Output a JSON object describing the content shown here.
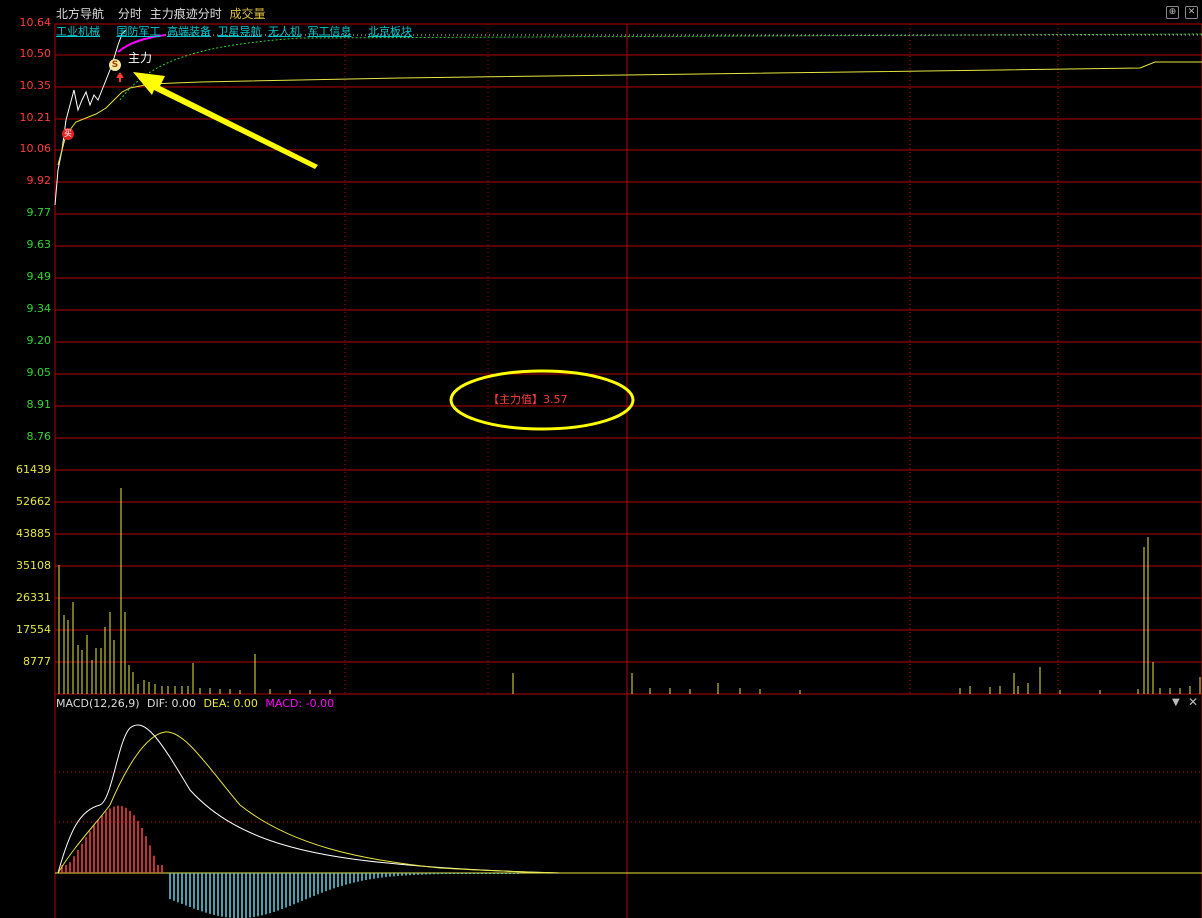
{
  "header": {
    "stock_name": "北方导航",
    "mode": "分时",
    "indicator": "主力痕迹分时",
    "volume_label": "成交量"
  },
  "concept_tags": [
    "工业机械",
    "国防军工",
    "高端装备",
    "卫星导航",
    "无人机",
    "军工信息",
    "北京板块"
  ],
  "price_axis": [
    "10.64",
    "10.50",
    "10.35",
    "10.21",
    "10.06",
    "9.92",
    "9.77",
    "9.63",
    "9.49",
    "9.34",
    "9.20",
    "9.05",
    "8.91",
    "8.76"
  ],
  "volume_axis": [
    "61439",
    "52662",
    "43885",
    "35108",
    "26331",
    "17554",
    "8777"
  ],
  "annotations": {
    "main_force_marker": "主力",
    "main_force_value_label": "【主力值】",
    "main_force_value": "3.57",
    "badge_top": "S",
    "badge_left": "买"
  },
  "macd": {
    "name": "MACD(12,26,9)",
    "dif_label": "DIF:",
    "dif_value": "0.00",
    "dea_label": "DEA:",
    "dea_value": "0.00",
    "macd_label": "MACD:",
    "macd_value": "-0.00"
  },
  "colors": {
    "grid": "#b40000",
    "price_up": "#ff3b3b",
    "price_down": "#2fd52f",
    "avg_line": "#e6e640",
    "volume_bar": "#e6e640",
    "macd_pos": "#ff4444",
    "macd_neg": "#5fd3e6",
    "macd_label": "#ff00ff",
    "arrow": "#ffff00",
    "tag": "#00c8d0"
  },
  "icons": {
    "top_right_1": "up-circle-icon",
    "top_right_2": "close-icon",
    "macd_dropdown": "chevron-down-icon",
    "macd_close": "close-icon"
  }
}
